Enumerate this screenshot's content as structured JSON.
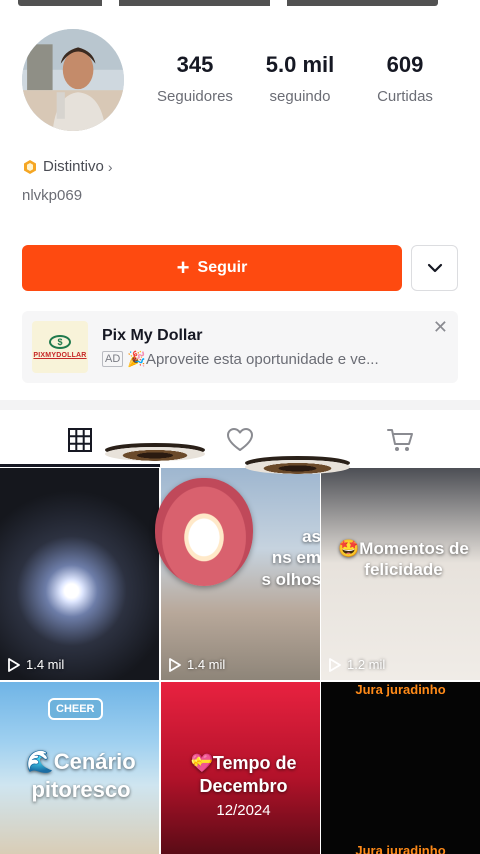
{
  "profile": {
    "username": "nlvkp069",
    "badge_label": "Distintivo",
    "badge_chevron": "›"
  },
  "stats": [
    {
      "value": "345",
      "label": "Seguidores"
    },
    {
      "value": "5.0 mil",
      "label": "seguindo"
    },
    {
      "value": "609",
      "label": "Curtidas"
    }
  ],
  "actions": {
    "follow_label": "Seguir",
    "follow_icon": "plus-icon",
    "dropdown_icon": "chevron-down-icon"
  },
  "ad": {
    "title": "Pix My Dollar",
    "tag": "AD",
    "description": "🎉Aproveite esta oportunidade e ve...",
    "logo_text": "PIXMYDOLLAR",
    "logo_symbol": "$",
    "close_icon": "close-icon"
  },
  "tabs": [
    {
      "icon": "grid-icon",
      "active": true
    },
    {
      "icon": "heart-icon",
      "active": false
    },
    {
      "icon": "cart-icon",
      "active": false
    }
  ],
  "videos": [
    {
      "views": "1.4 mil",
      "caption": ""
    },
    {
      "views": "1.4 mil",
      "caption": "as\nns em\ns olhos"
    },
    {
      "views": "1.2 mil",
      "caption": "🤩Momentos de felicidade"
    },
    {
      "views": "",
      "caption": "🌊Cenário pitoresco",
      "sticker": "CHEER"
    },
    {
      "views": "",
      "caption": "💝Tempo de Decembro",
      "date": "12/2024"
    },
    {
      "views": "",
      "top_text": "Jura juradinho",
      "bottom_text": "Jura juradinho"
    }
  ],
  "colors": {
    "accent": "#fe4a10",
    "text_primary": "#161823",
    "text_secondary": "#6b6d75"
  }
}
